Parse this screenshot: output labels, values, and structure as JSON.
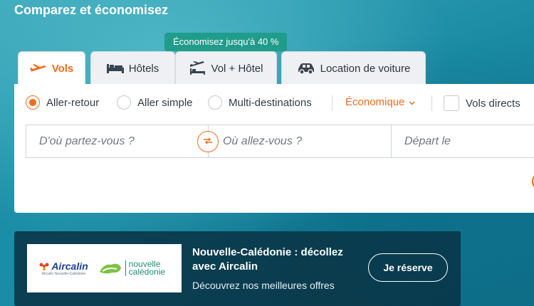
{
  "header": {
    "title": "Comparez et économisez"
  },
  "promo_tooltip": "Économisez jusqu'à 40 %",
  "tabs": [
    {
      "label": "Vols",
      "icon": "plane-icon",
      "active": true
    },
    {
      "label": "Hôtels",
      "icon": "bed-icon",
      "active": false
    },
    {
      "label": "Vol + Hôtel",
      "icon": "plane-bed-icon",
      "active": false
    },
    {
      "label": "Location de voiture",
      "icon": "car-icon",
      "active": false
    }
  ],
  "trip_type": {
    "options": [
      "Aller-retour",
      "Aller simple",
      "Multi-destinations"
    ],
    "selected": "Aller-retour"
  },
  "cabin_class": {
    "value": "Économique"
  },
  "direct_flights": {
    "label": "Vols directs",
    "checked": false
  },
  "search": {
    "origin_placeholder": "D'où partez-vous ?",
    "destination_placeholder": "Où allez-vous ?",
    "depart_placeholder": "Départ le"
  },
  "banner": {
    "logo_airline": "Aircalin",
    "logo_airline_tagline": "Aircalin Nouvelle-Calédonie",
    "logo_destination": "nouvelle calédonie",
    "title": "Nouvelle-Calédonie : décollez avec Aircalin",
    "subtitle": "Découvrez nos meilleures offres",
    "cta": "Je réserve"
  },
  "colors": {
    "accent": "#f06b1d",
    "promo": "#1f9c8a",
    "banner_bg": "#093446"
  }
}
